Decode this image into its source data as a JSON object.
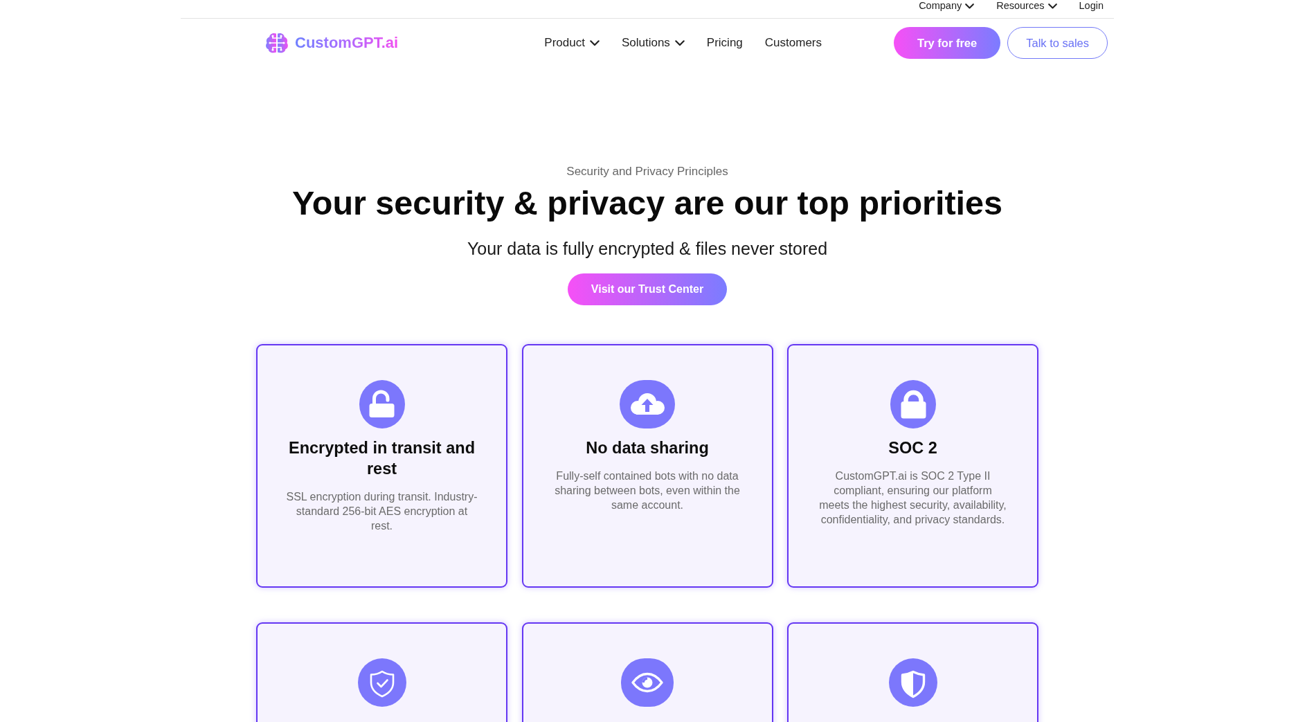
{
  "top_bar": {
    "links": [
      {
        "label": "Company",
        "dropdown": true
      },
      {
        "label": "Resources",
        "dropdown": true
      },
      {
        "label": "Login",
        "dropdown": false
      }
    ]
  },
  "header": {
    "logo": "CustomGPT.ai",
    "nav": [
      {
        "label": "Product",
        "dropdown": true
      },
      {
        "label": "Solutions",
        "dropdown": true
      },
      {
        "label": "Pricing",
        "dropdown": false
      },
      {
        "label": "Customers",
        "dropdown": false
      }
    ],
    "buttons": [
      {
        "label": "Try for free",
        "kind": "primary"
      },
      {
        "label": "Talk to sales",
        "kind": "outline"
      }
    ]
  },
  "hero": {
    "eyebrow": "Security and Privacy Principles",
    "title": "Your security & privacy are our top priorities",
    "subtitle": "Your data is fully encrypted & files never stored",
    "button": "Visit our Trust Center"
  },
  "features": [
    {
      "kind": "unlock",
      "title": "Encrypted in transit and rest",
      "description": "SSL encryption during transit. Industry-standard 256-bit AES encryption at rest."
    },
    {
      "kind": "upload",
      "title": "No data sharing",
      "description": "Fully-self contained bots with no data sharing between bots, even within the same account."
    },
    {
      "kind": "lock",
      "title": "SOC 2",
      "description": "CustomGPT.ai is SOC 2 Type II compliant, ensuring our platform meets the highest security, availability, confidentiality, and privacy standards."
    },
    {
      "kind": "verified"
    },
    {
      "kind": "view"
    },
    {
      "kind": "protect"
    }
  ]
}
